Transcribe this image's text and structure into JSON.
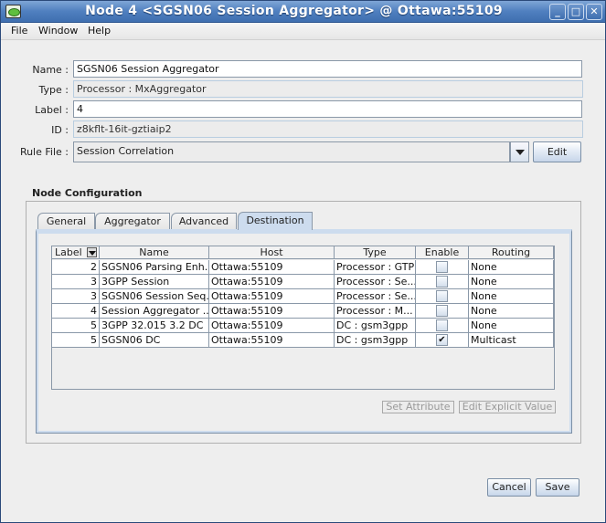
{
  "window": {
    "title": "Node 4 <SGSN06 Session Aggregator> @ Ottawa:55109",
    "controls": {
      "minimize": "_",
      "maximize": "□",
      "close": "✕"
    }
  },
  "menu": [
    "File",
    "Window",
    "Help"
  ],
  "form": {
    "name": {
      "label": "Name :",
      "value": "SGSN06 Session Aggregator"
    },
    "type": {
      "label": "Type :",
      "value": "Processor : MxAggregator"
    },
    "node_label": {
      "label": "Label :",
      "value": "4"
    },
    "id": {
      "label": "ID :",
      "value": "z8kflt-16it-gztiaip2"
    },
    "rule_file": {
      "label": "Rule File :",
      "value": "Session Correlation",
      "edit_label": "Edit"
    }
  },
  "node_config": {
    "title": "Node Configuration",
    "tabs": [
      "General",
      "Aggregator",
      "Advanced",
      "Destination"
    ],
    "active_tab": "Destination",
    "table": {
      "columns": [
        "Label",
        "Name",
        "Host",
        "Type",
        "Enable",
        "Routing"
      ],
      "rows": [
        {
          "label": "2",
          "name": "SGSN06 Parsing Enh...",
          "host": "Ottawa:55109",
          "type": "Processor : GTP",
          "enable": "",
          "routing": "None"
        },
        {
          "label": "3",
          "name": "3GPP Session",
          "host": "Ottawa:55109",
          "type": "Processor : Se...",
          "enable": "",
          "routing": "None"
        },
        {
          "label": "3",
          "name": "SGSN06 Session Seq...",
          "host": "Ottawa:55109",
          "type": "Processor : Se...",
          "enable": "",
          "routing": "None"
        },
        {
          "label": "4",
          "name": "Session Aggregator ...",
          "host": "Ottawa:55109",
          "type": "Processor : M...",
          "enable": "",
          "routing": "None"
        },
        {
          "label": "5",
          "name": "3GPP 32.015 3.2 DC",
          "host": "Ottawa:55109",
          "type": "DC : gsm3gpp",
          "enable": "",
          "routing": "None"
        },
        {
          "label": "5",
          "name": "SGSN06 DC",
          "host": "Ottawa:55109",
          "type": "DC : gsm3gpp",
          "enable": "✔",
          "routing": "Multicast"
        }
      ]
    },
    "set_attribute_label": "Set Attribute",
    "edit_explicit_label": "Edit Explicit Value"
  },
  "footer": {
    "cancel_label": "Cancel",
    "save_label": "Save"
  }
}
